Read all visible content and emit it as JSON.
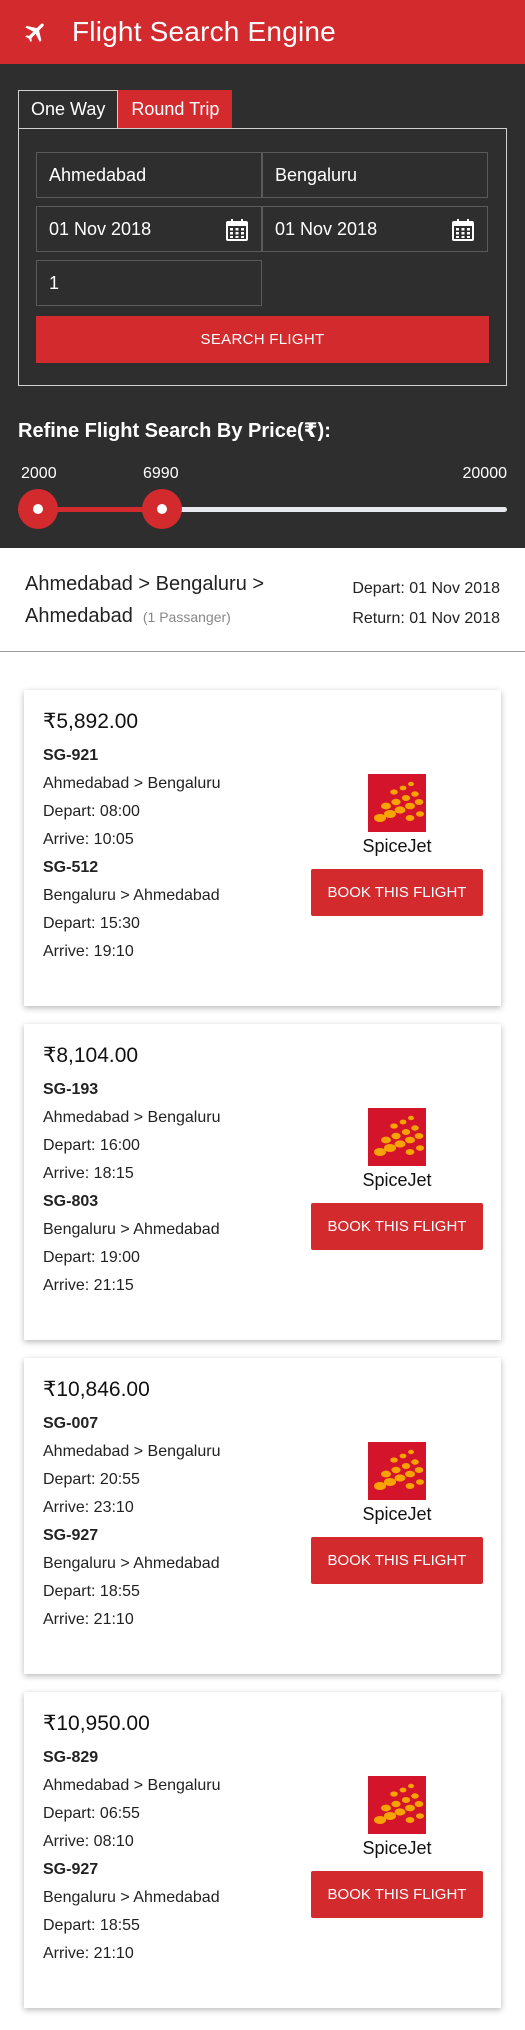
{
  "header": {
    "title": "Flight Search Engine",
    "icon": "plane-icon",
    "color": "#d32a2e"
  },
  "search": {
    "tabs": [
      "One Way",
      "Round Trip"
    ],
    "active_tab": "Round Trip",
    "origin": "Ahmedabad",
    "destination": "Bengaluru",
    "depart_date": "01 Nov 2018",
    "return_date": "01 Nov 2018",
    "passengers": "1",
    "button_label": "SEARCH FLIGHT"
  },
  "refine": {
    "title": "Refine Flight Search By Price(₹):",
    "min_label": "2000",
    "current_label": "6990",
    "max_label": "20000",
    "min": 2000,
    "max": 20000,
    "value": 6990
  },
  "summary": {
    "route": "Ahmedabad > Bengaluru > Ahmedabad",
    "passengers": "(1 Passanger)",
    "depart": "Depart: 01 Nov 2018",
    "return": "Return: 01 Nov 2018"
  },
  "results": [
    {
      "price": "₹5,892.00",
      "outbound": {
        "code": "SG-921",
        "route": "Ahmedabad > Bengaluru",
        "depart": "Depart: 08:00",
        "arrive": "Arrive: 10:05"
      },
      "inbound": {
        "code": "SG-512",
        "route": "Bengaluru > Ahmedabad",
        "depart": "Depart: 15:30",
        "arrive": "Arrive: 19:10"
      },
      "airline": "SpiceJet",
      "button_label": "BOOK THIS FLIGHT"
    },
    {
      "price": "₹8,104.00",
      "outbound": {
        "code": "SG-193",
        "route": "Ahmedabad > Bengaluru",
        "depart": "Depart: 16:00",
        "arrive": "Arrive: 18:15"
      },
      "inbound": {
        "code": "SG-803",
        "route": "Bengaluru > Ahmedabad",
        "depart": "Depart: 19:00",
        "arrive": "Arrive: 21:15"
      },
      "airline": "SpiceJet",
      "button_label": "BOOK THIS FLIGHT"
    },
    {
      "price": "₹10,846.00",
      "outbound": {
        "code": "SG-007",
        "route": "Ahmedabad > Bengaluru",
        "depart": "Depart: 20:55",
        "arrive": "Arrive: 23:10"
      },
      "inbound": {
        "code": "SG-927",
        "route": "Bengaluru > Ahmedabad",
        "depart": "Depart: 18:55",
        "arrive": "Arrive: 21:10"
      },
      "airline": "SpiceJet",
      "button_label": "BOOK THIS FLIGHT"
    },
    {
      "price": "₹10,950.00",
      "outbound": {
        "code": "SG-829",
        "route": "Ahmedabad > Bengaluru",
        "depart": "Depart: 06:55",
        "arrive": "Arrive: 08:10"
      },
      "inbound": {
        "code": "SG-927",
        "route": "Bengaluru > Ahmedabad",
        "depart": "Depart: 18:55",
        "arrive": "Arrive: 21:10"
      },
      "airline": "SpiceJet",
      "button_label": "BOOK THIS FLIGHT"
    }
  ]
}
